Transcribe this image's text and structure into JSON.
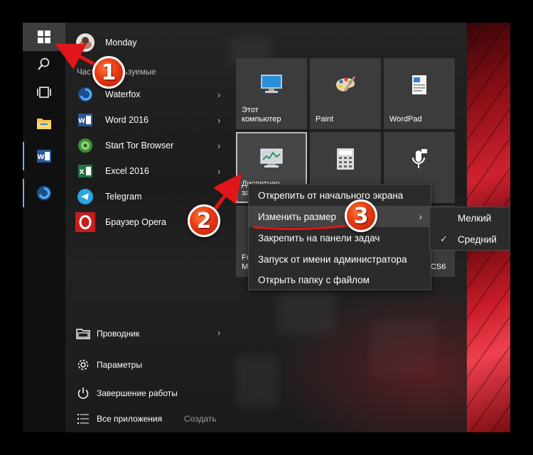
{
  "user": {
    "name": "Monday"
  },
  "frequent_header": "Часто используемые",
  "apps": [
    {
      "label": "Waterfox",
      "has_arrow": true
    },
    {
      "label": "Word 2016",
      "has_arrow": true
    },
    {
      "label": "Start Tor Browser",
      "has_arrow": true
    },
    {
      "label": "Excel 2016",
      "has_arrow": true
    },
    {
      "label": "Telegram",
      "has_arrow": false
    },
    {
      "label": "Браузер Opera",
      "has_arrow": false
    }
  ],
  "bottom": {
    "explorer": "Проводник",
    "settings": "Параметры",
    "shutdown": "Завершение работы",
    "all_apps": "Все приложения",
    "create": "Создать"
  },
  "tiles": {
    "this_pc": "Этот компьютер",
    "paint": "Paint",
    "wordpad": "WordPad",
    "task_manager": "Диспетчер задач",
    "partial_left": "Fr\nM",
    "partial_right": "CS6"
  },
  "context_menu": {
    "unpin": "Открепить от начального экрана",
    "resize": "Изменить размер",
    "pin_taskbar": "Закрепить на панели задач",
    "run_admin": "Запуск от имени администратора",
    "open_folder": "Открыть папку с файлом"
  },
  "resize_submenu": {
    "small": "Мелкий",
    "medium": "Средний",
    "selected": "medium"
  },
  "annotations": [
    "1",
    "2",
    "3"
  ],
  "colors": {
    "badge": "#e63a12",
    "arrow": "#e0161a",
    "tile": "#3c3c3c",
    "menu": "#2b2b2b"
  }
}
